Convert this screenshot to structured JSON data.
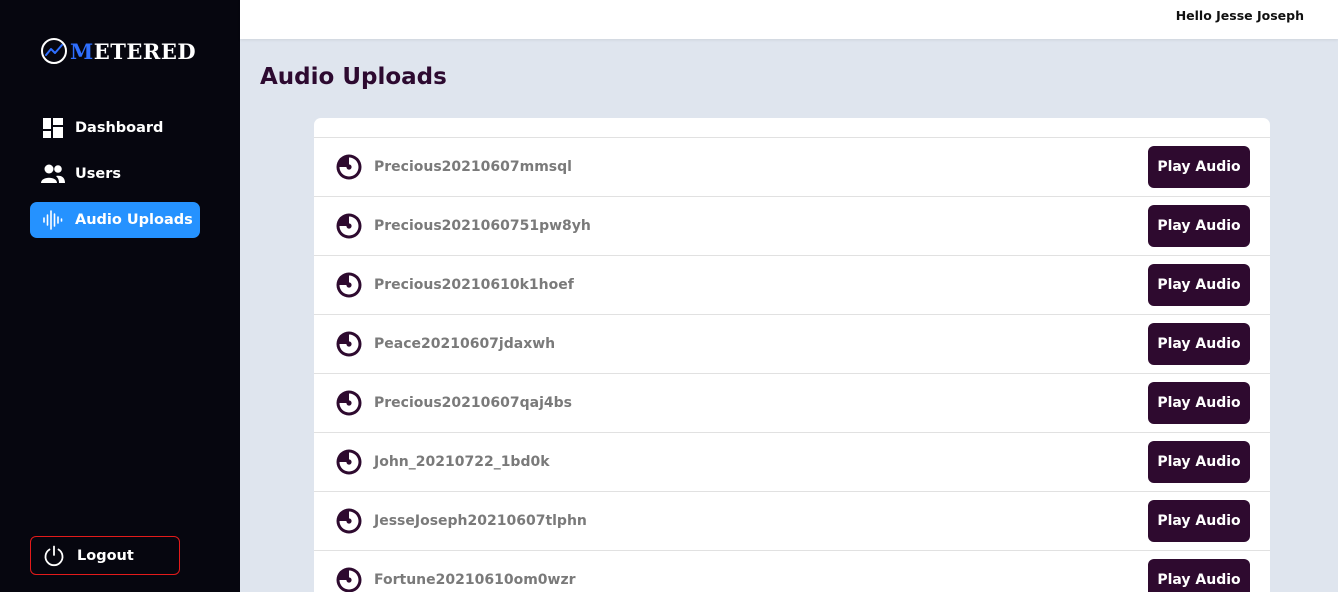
{
  "brand": {
    "logo_first": "M",
    "logo_rest": "ETERED",
    "accent_color": "#2f6fff",
    "icon": "chart-circle-icon"
  },
  "sidebar": {
    "items": [
      {
        "label": "Dashboard",
        "icon": "dashboard-grid-icon",
        "active": false
      },
      {
        "label": "Users",
        "icon": "users-icon",
        "active": false
      },
      {
        "label": "Audio Uploads",
        "icon": "audio-wave-icon",
        "active": true
      }
    ],
    "logout_label": "Logout",
    "logout_icon": "power-icon",
    "active_color": "#2592ff",
    "logout_border_color": "#e21a1a"
  },
  "header": {
    "greeting": "Hello Jesse Joseph"
  },
  "main": {
    "title": "Audio Uploads",
    "button_color": "#2e0a2f",
    "uploads": [
      {
        "name": "Precious20210607mmsql",
        "action": "Play Audio"
      },
      {
        "name": "Precious2021060751pw8yh",
        "action": "Play Audio"
      },
      {
        "name": "Precious20210610k1hoef",
        "action": "Play Audio"
      },
      {
        "name": "Peace20210607jdaxwh",
        "action": "Play Audio"
      },
      {
        "name": "Precious20210607qaj4bs",
        "action": "Play Audio"
      },
      {
        "name": "John_20210722_1bd0k",
        "action": "Play Audio"
      },
      {
        "name": "JesseJoseph20210607tlphn",
        "action": "Play Audio"
      },
      {
        "name": "Fortune20210610om0wzr",
        "action": "Play Audio"
      }
    ]
  }
}
